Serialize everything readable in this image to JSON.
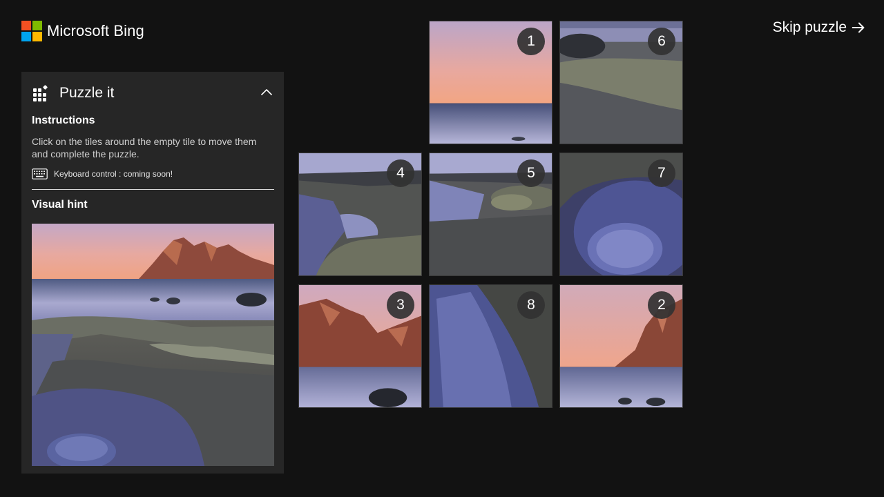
{
  "brand": {
    "name": "Microsoft Bing",
    "logo_colors": [
      "#f25022",
      "#7fba00",
      "#00a4ef",
      "#ffb900"
    ]
  },
  "skip": {
    "label": "Skip puzzle",
    "icon": "arrow-right-icon"
  },
  "panel": {
    "title": "Puzzle it",
    "icon": "puzzle-grid-icon",
    "collapse_icon": "chevron-up-icon",
    "instructions_heading": "Instructions",
    "instructions_text": "Click on the tiles around the empty tile to move them and complete the puzzle.",
    "keyboard_icon": "keyboard-icon",
    "keyboard_note": "Keyboard control : coming soon!",
    "hint_heading": "Visual hint"
  },
  "board": {
    "empty_cell": "top-left",
    "tiles": [
      {
        "number": "1",
        "cell": "top-center"
      },
      {
        "number": "6",
        "cell": "top-right"
      },
      {
        "number": "4",
        "cell": "middle-left"
      },
      {
        "number": "5",
        "cell": "middle-center"
      },
      {
        "number": "7",
        "cell": "middle-right"
      },
      {
        "number": "3",
        "cell": "bottom-left"
      },
      {
        "number": "8",
        "cell": "bottom-center"
      },
      {
        "number": "2",
        "cell": "bottom-right"
      }
    ]
  },
  "colors": {
    "background": "#121212",
    "panel": "#262626",
    "badge": "#323232"
  }
}
